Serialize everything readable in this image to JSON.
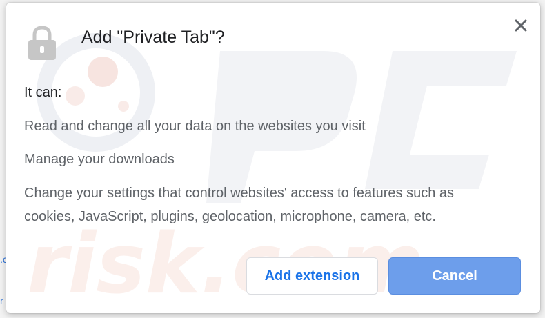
{
  "dialog": {
    "title": "Add \"Private Tab\"?",
    "icons": {
      "extension": "lock-icon",
      "close": "close-icon"
    },
    "intro": "It can:",
    "permissions": [
      "Read and change all your data on the websites you visit",
      "Manage your downloads",
      "Change your settings that control websites' access to features such as",
      "cookies, JavaScript, plugins, geolocation, microphone, camera, etc."
    ],
    "buttons": {
      "add_label": "Add extension",
      "cancel_label": "Cancel"
    }
  },
  "colors": {
    "accent": "#1a73e8",
    "primary_button": "#6d9eeb",
    "text_primary": "#202124",
    "text_secondary": "#5f6368"
  }
}
